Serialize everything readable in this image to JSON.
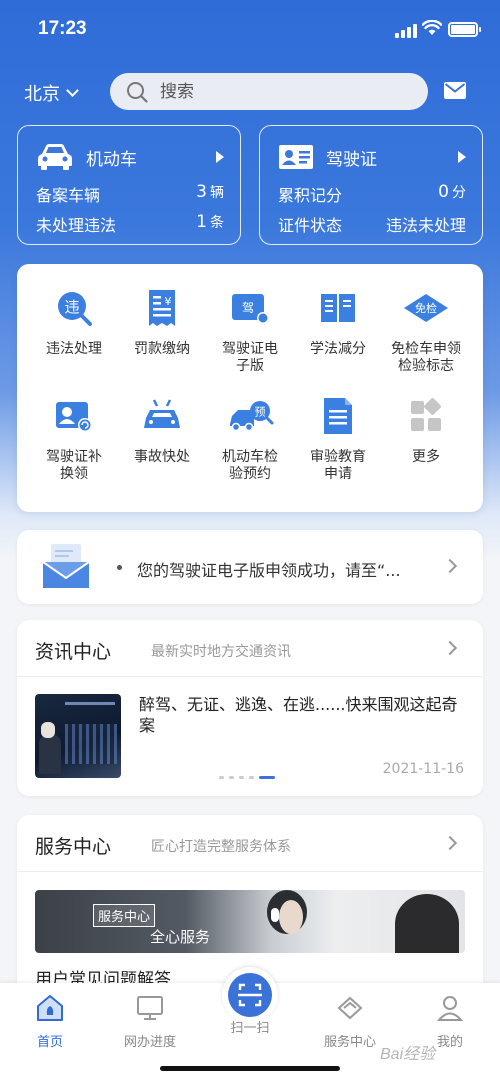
{
  "status_bar": {
    "time": "17:23"
  },
  "header": {
    "city": "北京",
    "search_placeholder": "搜索"
  },
  "vehicle_card": {
    "title": "机动车",
    "rows": [
      {
        "label": "备案车辆",
        "value": "3",
        "unit": "辆"
      },
      {
        "label": "未处理违法",
        "value": "1",
        "unit": "条"
      }
    ]
  },
  "license_card": {
    "title": "驾驶证",
    "rows": [
      {
        "label": "累积记分",
        "value": "0",
        "unit": "分"
      },
      {
        "label": "证件状态",
        "value": "违法未处理"
      }
    ]
  },
  "services": [
    {
      "label": "违法处理",
      "icon": "violation-icon"
    },
    {
      "label": "罚款缴纳",
      "icon": "fine-payment-icon"
    },
    {
      "label": "驾驶证电子版",
      "icon": "e-license-icon",
      "icon_text": "驾"
    },
    {
      "label": "学法减分",
      "icon": "book-icon"
    },
    {
      "label": "免检车申领检验标志",
      "icon": "exemption-icon",
      "icon_text": "免检"
    },
    {
      "label": "驾驶证补换领",
      "icon": "license-replace-icon"
    },
    {
      "label": "事故快处",
      "icon": "accident-icon"
    },
    {
      "label": "机动车检验预约",
      "icon": "inspection-appointment-icon",
      "icon_text": "预"
    },
    {
      "label": "审验教育申请",
      "icon": "document-icon"
    },
    {
      "label": "更多",
      "icon": "more-icon"
    }
  ],
  "notice": {
    "text": "您的驾驶证电子版申领成功，请至“..."
  },
  "news": {
    "title": "资讯中心",
    "subtitle": "最新实时地方交通资讯",
    "headline": "醉驾、无证、逃逸、在逃......快来围观这起奇案",
    "date": "2021-11-16",
    "pages": 5,
    "active_page": 5
  },
  "service_center": {
    "title": "服务中心",
    "subtitle": "匠心打造完整服务体系",
    "banner_tag": "服务中心",
    "banner_slogan": "全心服务",
    "faq_title": "用户常见问题解答"
  },
  "tabs": [
    {
      "label": "首页",
      "icon": "home-icon",
      "active": true
    },
    {
      "label": "网办进度",
      "icon": "monitor-icon",
      "active": false
    },
    {
      "label": "扫一扫",
      "icon": "scan-icon",
      "active": false
    },
    {
      "label": "服务中心",
      "icon": "service-icon",
      "active": false
    },
    {
      "label": "我的",
      "icon": "profile-icon",
      "active": false
    }
  ],
  "watermark": "Bai经验",
  "colors": {
    "primary": "#2f6cd8",
    "accent": "#3a72d8"
  }
}
